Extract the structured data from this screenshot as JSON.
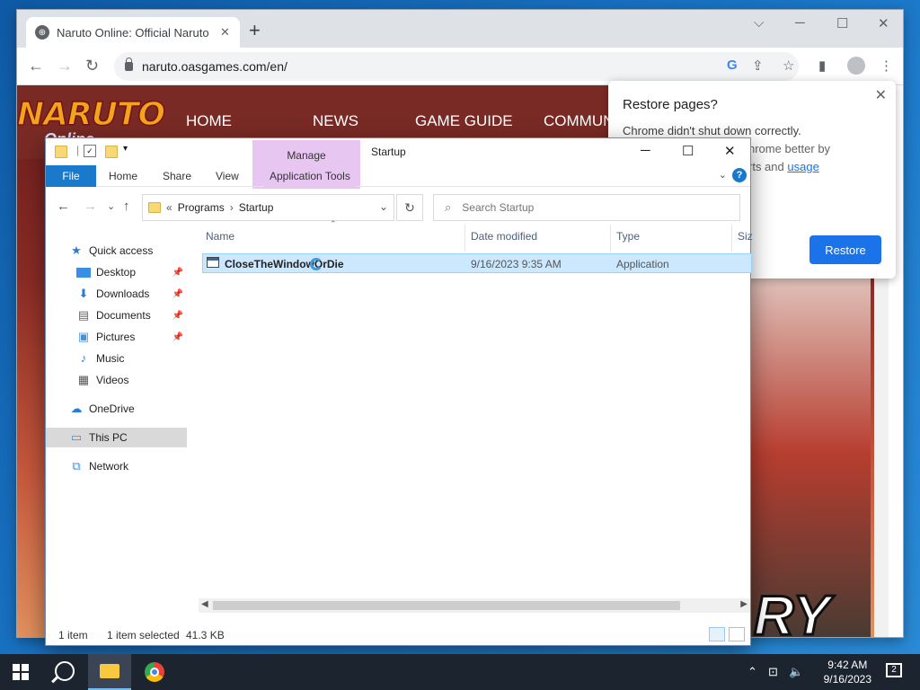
{
  "chrome": {
    "tab_title": "Naruto Online: Official Naruto",
    "tab_close": "✕",
    "new_tab": "+",
    "url": "naruto.oasgames.com/en/",
    "minimize": "─",
    "maximize": "☐",
    "close": "✕",
    "tab_search": "⌵"
  },
  "site": {
    "logo_main": "NARUTO",
    "logo_sub": "Online",
    "nav": [
      "HOME",
      "NEWS",
      "GAME GUIDE",
      "COMMUN"
    ],
    "big_text": "RY"
  },
  "restore": {
    "title": "Restore pages?",
    "message_line1": "Chrome didn't shut down correctly.",
    "message_line2_fragment": "hrome better by",
    "message_line3_fragment": "rts and",
    "link": "usage",
    "button": "Restore"
  },
  "explorer": {
    "title": "Startup",
    "manage_tab": "Manage",
    "ribbon_tabs": [
      "File",
      "Home",
      "Share",
      "View",
      "Application Tools"
    ],
    "breadcrumb": [
      "Programs",
      "Startup"
    ],
    "breadcrumb_prefix": "«",
    "search_placeholder": "Search Startup",
    "nav": {
      "quick_access": "Quick access",
      "items": [
        {
          "label": "Desktop",
          "icon": "desktop-icon"
        },
        {
          "label": "Downloads",
          "icon": "download-icon"
        },
        {
          "label": "Documents",
          "icon": "document-icon"
        },
        {
          "label": "Pictures",
          "icon": "picture-icon"
        },
        {
          "label": "Music",
          "icon": "music-icon"
        },
        {
          "label": "Videos",
          "icon": "video-icon"
        }
      ],
      "onedrive": "OneDrive",
      "this_pc": "This PC",
      "network": "Network"
    },
    "columns": [
      "Name",
      "Date modified",
      "Type",
      "Siz"
    ],
    "files": [
      {
        "name": "CloseTheWindowOrDie",
        "date": "9/16/2023 9:35 AM",
        "type": "Application"
      }
    ],
    "status_count": "1 item",
    "status_selected": "1 item selected",
    "status_size": "41.3 KB"
  },
  "taskbar": {
    "time": "9:42 AM",
    "date": "9/16/2023",
    "notifications": "2"
  },
  "colors": {
    "accent": "#1979ca",
    "selection": "#cce8ff",
    "manage_tab": "#e8c6f2",
    "restore_button": "#1a73e8"
  }
}
